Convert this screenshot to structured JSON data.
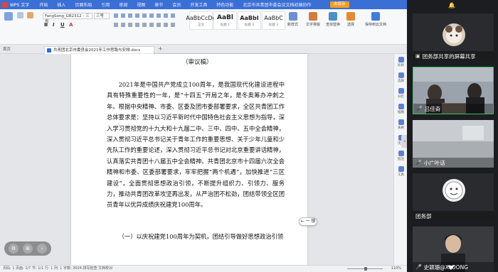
{
  "window": {
    "app_name": "WPS 文字",
    "menu": [
      "开始",
      "插入",
      "页面布局",
      "引用",
      "审阅",
      "视图",
      "章节",
      "会员",
      "开发工具",
      "特色功能",
      "北京市共青团市委会议文档初稿协作"
    ],
    "save_button": "未保存",
    "home_tab": "首页",
    "doc_tab": "共青团北京市委员会2021年工作思路与安排.docx",
    "add_tab": "+"
  },
  "ribbon": {
    "font_name": "FangSong_GB2312 - 三号",
    "font_size": "三号",
    "styles": [
      {
        "sample": "AaBbCcDd",
        "name": "正文"
      },
      {
        "sample": "AaBl",
        "name": "标题 1"
      },
      {
        "sample": "AaBbI",
        "name": "标题 2"
      },
      {
        "sample": "AaBbC",
        "name": "标题 3"
      }
    ],
    "tools": [
      "新样式",
      "文字排版",
      "查找替换",
      "选择",
      "保存到云文档",
      "保存"
    ],
    "format_buttons": [
      "B",
      "I",
      "U",
      "A"
    ]
  },
  "document": {
    "tag": "（审议稿）",
    "body": "2021年是中国共产党成立100周年，是我国现代化建设进程中具有特殊重要性的一年，是“十四五”开局之年，是冬奥筹办冲刺之年。根据中央精神、市委、区委及团市委部署要求，全区共青团工作总体要求是：坚持以习近平新时代中国特色社会主义思想为指导，深入学习贯彻党的十九大和十九届二中、三中、四中、五中全会精神，深入贯彻习近平总书记关于青年工作的重要思想、关于少年儿童和少先队工作的重要论述，深入贯彻习近平总书记对北京重要讲话精神，认真落实共青团十八届五中全会精神、共青团北京市十四届六次全会精神和市委、区委部署要求，牢牢把握“两个机遇”，加快推进“三区建设”，全面贯彻思想政治引领，不断提升组织力、引领力、服务力，推动共青团改革攻坚再出发，从严治团不松劲，团结带领全区团员青年以优异成绩庆祝建党100周年。",
    "section_heading": "（一）以庆祝建党100周年为契机，团结引导做好思想政治引领",
    "overlay_button": "← 一 锁"
  },
  "right_tools": [
    "形状",
    "选择",
    "分栏",
    "插图",
    "表格",
    "页眉",
    "批注",
    "工具"
  ],
  "status": {
    "text": "页码: 1  页面: 1/7  节: 1/1  行: 1  列: 1  字数: 3024  拼写检查  文档校对",
    "zoom": "110%"
  },
  "screenshare_controls": [
    "⚙",
    "⊞",
    "‹"
  ],
  "meeting": {
    "tiles": [
      {
        "name": "团务部共享的屏幕共享",
        "has_mic": false
      },
      {
        "name": "吕佳奇",
        "has_mic": true
      },
      {
        "name": "小广叶话",
        "has_mic": true
      },
      {
        "name": "团务部",
        "has_mic": false
      },
      {
        "name": "史颖珊@XLOONG",
        "has_mic": true
      }
    ],
    "side_arrow": "›"
  },
  "colors": {
    "titlebar": "#3a6fd6",
    "save_button": "#f59d23",
    "meeting_bg": "#1c1d20"
  }
}
